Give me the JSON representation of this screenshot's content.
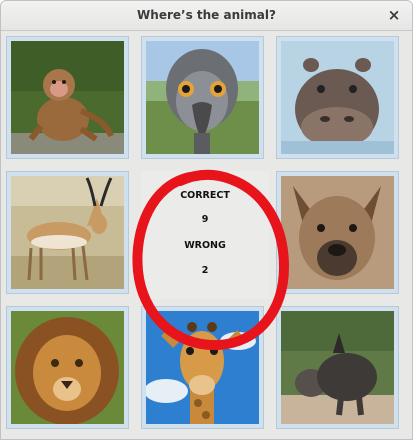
{
  "window": {
    "title": "Where’s the animal?",
    "close_glyph": "×"
  },
  "tiles": [
    {
      "animal": "monkey",
      "icon": "monkey-icon"
    },
    {
      "animal": "emu",
      "icon": "emu-icon"
    },
    {
      "animal": "hippo",
      "icon": "hippo-icon"
    },
    {
      "animal": "gazelle",
      "icon": "gazelle-icon"
    },
    {
      "animal": "hyena",
      "icon": "hyena-icon"
    },
    {
      "animal": "lion",
      "icon": "lion-icon"
    },
    {
      "animal": "giraffe",
      "icon": "giraffe-icon"
    },
    {
      "animal": "rhino",
      "icon": "rhino-icon"
    }
  ],
  "score": {
    "correct_label": "CORRECT",
    "correct_value": "9",
    "wrong_label": "WRONG",
    "wrong_value": "2"
  },
  "colors": {
    "annotation_circle": "#e8141b",
    "tile_border": "#b7c9d8",
    "tile_bg": "#cfe0ee"
  }
}
